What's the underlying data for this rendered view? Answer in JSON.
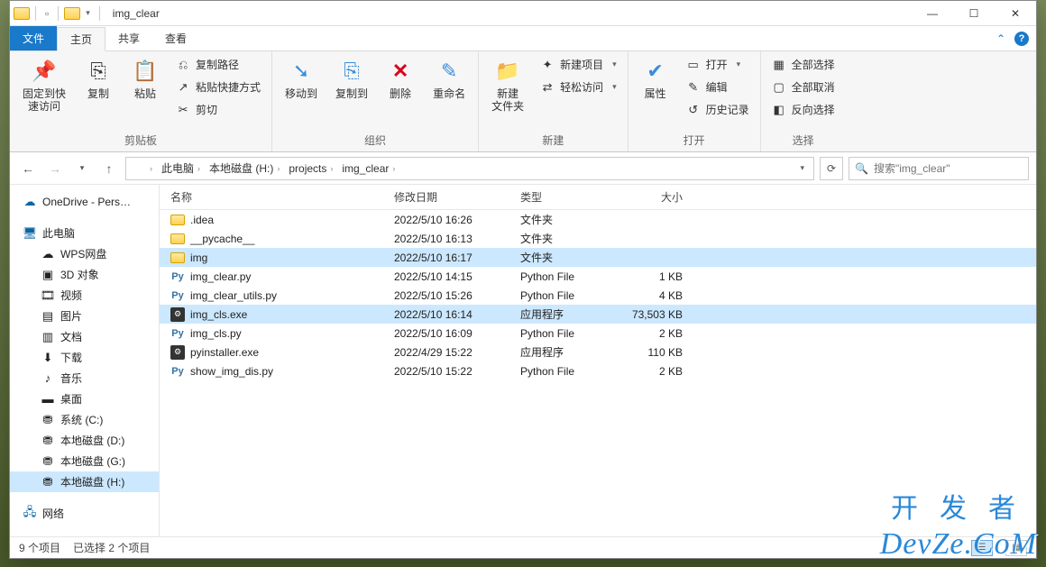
{
  "title": "img_clear",
  "tabs": {
    "file": "文件",
    "home": "主页",
    "share": "共享",
    "view": "查看"
  },
  "ribbon": {
    "clipboard": {
      "label": "剪贴板",
      "pin": "固定到快\n速访问",
      "copy": "复制",
      "paste": "粘贴",
      "copy_path": "复制路径",
      "paste_shortcut": "粘贴快捷方式",
      "cut": "剪切"
    },
    "organize": {
      "label": "组织",
      "move_to": "移动到",
      "copy_to": "复制到",
      "delete": "删除",
      "rename": "重命名"
    },
    "new": {
      "label": "新建",
      "new_folder": "新建\n文件夹",
      "new_item": "新建项目",
      "easy_access": "轻松访问"
    },
    "open": {
      "label": "打开",
      "properties": "属性",
      "open": "打开",
      "edit": "编辑",
      "history": "历史记录"
    },
    "select": {
      "label": "选择",
      "select_all": "全部选择",
      "select_none": "全部取消",
      "invert": "反向选择"
    }
  },
  "breadcrumb": {
    "this_pc": "此电脑",
    "drive": "本地磁盘 (H:)",
    "projects": "projects",
    "folder": "img_clear"
  },
  "search_placeholder": "搜索\"img_clear\"",
  "nav": {
    "onedrive": "OneDrive - Pers…",
    "this_pc": "此电脑",
    "items": [
      {
        "label": "WPS网盘",
        "icon": "☁"
      },
      {
        "label": "3D 对象",
        "icon": "▣"
      },
      {
        "label": "视频",
        "icon": "🎞"
      },
      {
        "label": "图片",
        "icon": "▤"
      },
      {
        "label": "文档",
        "icon": "▥"
      },
      {
        "label": "下载",
        "icon": "⬇"
      },
      {
        "label": "音乐",
        "icon": "♪"
      },
      {
        "label": "桌面",
        "icon": "▬"
      },
      {
        "label": "系统 (C:)",
        "icon": "⛃"
      },
      {
        "label": "本地磁盘 (D:)",
        "icon": "⛃"
      },
      {
        "label": "本地磁盘 (G:)",
        "icon": "⛃"
      },
      {
        "label": "本地磁盘 (H:)",
        "icon": "⛃",
        "selected": true
      }
    ],
    "network": "网络"
  },
  "columns": {
    "name": "名称",
    "date": "修改日期",
    "type": "类型",
    "size": "大小"
  },
  "files": [
    {
      "name": ".idea",
      "date": "2022/5/10 16:26",
      "type": "文件夹",
      "size": "",
      "icon": "folder"
    },
    {
      "name": "__pycache__",
      "date": "2022/5/10 16:13",
      "type": "文件夹",
      "size": "",
      "icon": "folder"
    },
    {
      "name": "img",
      "date": "2022/5/10 16:17",
      "type": "文件夹",
      "size": "",
      "icon": "folder",
      "selected": true
    },
    {
      "name": "img_clear.py",
      "date": "2022/5/10 14:15",
      "type": "Python File",
      "size": "1 KB",
      "icon": "py"
    },
    {
      "name": "img_clear_utils.py",
      "date": "2022/5/10 15:26",
      "type": "Python File",
      "size": "4 KB",
      "icon": "py"
    },
    {
      "name": "img_cls.exe",
      "date": "2022/5/10 16:14",
      "type": "应用程序",
      "size": "73,503 KB",
      "icon": "exe",
      "selected": true
    },
    {
      "name": "img_cls.py",
      "date": "2022/5/10 16:09",
      "type": "Python File",
      "size": "2 KB",
      "icon": "py"
    },
    {
      "name": "pyinstaller.exe",
      "date": "2022/4/29 15:22",
      "type": "应用程序",
      "size": "110 KB",
      "icon": "exe"
    },
    {
      "name": "show_img_dis.py",
      "date": "2022/5/10 15:22",
      "type": "Python File",
      "size": "2 KB",
      "icon": "py"
    }
  ],
  "status": {
    "items": "9 个项目",
    "selected": "已选择 2 个项目"
  },
  "watermark": {
    "cn": "开发者",
    "en": "DevZe.CoM"
  }
}
